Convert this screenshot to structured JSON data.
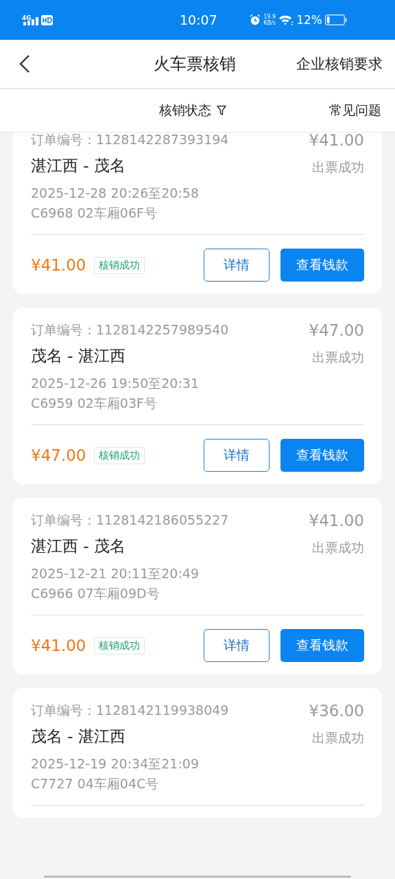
{
  "status_bar": {
    "network": "4G",
    "time": "10:07",
    "speed_value": "19.9",
    "speed_unit": "KB/s",
    "battery": "12%"
  },
  "header": {
    "title": "火车票核销",
    "action": "企业核销要求"
  },
  "filter_bar": {
    "filter": "核销状态",
    "faq": "常见问题"
  },
  "orders": [
    {
      "order_label": "订单编号：",
      "order_no": "1128142287393194",
      "price": "¥41.00",
      "route": "湛江西 - 茂名",
      "ticket_status": "出票成功",
      "time": "2025-12-28 20:26至20:58",
      "seat": "C6968 02车厢06F号",
      "amount": "¥41.00",
      "verify_status": "核销成功",
      "buttons": [
        "详情",
        "查看钱款"
      ]
    },
    {
      "order_label": "订单编号：",
      "order_no": "1128142257989540",
      "price": "¥47.00",
      "route": "茂名 - 湛江西",
      "ticket_status": "出票成功",
      "time": "2025-12-26 19:50至20:31",
      "seat": "C6959 02车厢03F号",
      "amount": "¥47.00",
      "verify_status": "核销成功",
      "buttons": [
        "详情",
        "查看钱款"
      ]
    },
    {
      "order_label": "订单编号：",
      "order_no": "1128142186055227",
      "price": "¥41.00",
      "route": "湛江西 - 茂名",
      "ticket_status": "出票成功",
      "time": "2025-12-21 20:11至20:49",
      "seat": "C6966 07车厢09D号",
      "amount": "¥41.00",
      "verify_status": "核销成功",
      "buttons": [
        "详情",
        "查看钱款"
      ]
    },
    {
      "order_label": "订单编号：",
      "order_no": "1128142119938049",
      "price": "¥36.00",
      "route": "茂名 - 湛江西",
      "ticket_status": "出票成功",
      "time": "2025-12-19 20:34至21:09",
      "seat": "C7727 04车厢04C号"
    }
  ]
}
